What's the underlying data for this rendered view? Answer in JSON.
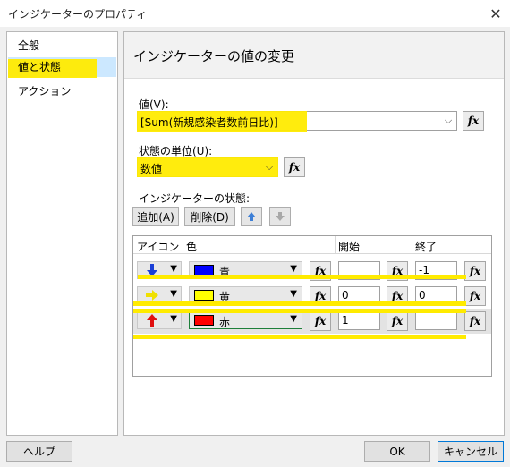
{
  "window": {
    "title": "インジケーターのプロパティ",
    "close_glyph": "✕"
  },
  "nav": {
    "items": [
      {
        "label": "全般",
        "selected": false
      },
      {
        "label": "値と状態",
        "selected": true
      },
      {
        "label": "アクション",
        "selected": false
      }
    ]
  },
  "main": {
    "title": "インジケーターの値の変更",
    "value_label": "値(V):",
    "value_field": "[Sum(新規感染者数前日比)]",
    "unit_label": "状態の単位(U):",
    "unit_field": "数値",
    "states_label": "インジケーターの状態:",
    "add_button": "追加(A)",
    "delete_button": "削除(D)",
    "fx_label": "fx",
    "grid": {
      "headers": {
        "icon": "アイコン",
        "color": "色",
        "start": "開始",
        "end": "終了"
      },
      "rows": [
        {
          "icon": "down-arrow-icon",
          "icon_color": "#1a3fd6",
          "color_name": "青",
          "swatch": "#0000ff",
          "start": "",
          "end": "-1"
        },
        {
          "icon": "right-arrow-icon",
          "icon_color": "#f0e000",
          "color_name": "黄",
          "swatch": "#ffff00",
          "start": "0",
          "end": "0"
        },
        {
          "icon": "up-arrow-icon",
          "icon_color": "#e01010",
          "color_name": "赤",
          "swatch": "#ff0000",
          "start": "1",
          "end": ""
        }
      ]
    }
  },
  "footer": {
    "help_button": "ヘルプ",
    "ok_button": "OK",
    "cancel_button": "キャンセル"
  },
  "colors": {
    "highlight": "#ffeb00",
    "selection": "#cce8ff",
    "accent": "#0078d7"
  }
}
